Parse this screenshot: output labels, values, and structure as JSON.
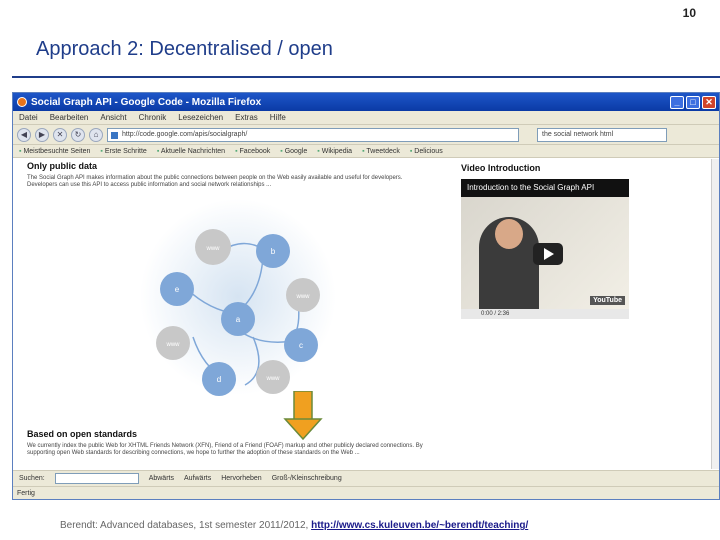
{
  "slide": {
    "number": "10",
    "title": "Approach 2: Decentralised / open",
    "footer_text": "Berendt: Advanced databases, 1st semester 2011/2012, ",
    "footer_link": "http://www.cs.kuleuven.be/~berendt/teaching/"
  },
  "browser": {
    "window_title": "Social Graph API - Google Code - Mozilla Firefox",
    "window_buttons": [
      "_",
      "□",
      "✕"
    ],
    "menu": [
      "Datei",
      "Bearbeiten",
      "Ansicht",
      "Chronik",
      "Lesezeichen",
      "Extras",
      "Hilfe"
    ],
    "nav_buttons": [
      "◀",
      "▶",
      "✕",
      "↻",
      "⌂"
    ],
    "url": "http://code.google.com/apis/socialgraph/",
    "search_value": "the social network html",
    "bookmarks": [
      "Meistbesuchte Seiten",
      "Erste Schritte",
      "Aktuelle Nachrichten",
      "Facebook",
      "Google",
      "Wikipedia",
      "Tweetdeck",
      "Delicious"
    ],
    "find_label": "Suchen:",
    "find_buttons": [
      "Abwärts",
      "Aufwärts",
      "Hervorheben",
      "Groß-/Kleinschreibung"
    ],
    "status": "Fertig"
  },
  "page": {
    "heading_public": "Only public data",
    "public_text": "The Social Graph API makes information about the public connections between people on the Web easily available and useful for developers. Developers can use this API to access public information and social network relationships ...",
    "heading_standards": "Based on open standards",
    "standards_text": "We currently index the public Web for XHTML Friends Network (XFN), Friend of a Friend (FOAF) markup and other publicly declared connections. By supporting open Web standards for describing connections, we hope to further the adoption of these standards on the Web ...",
    "video_heading": "Video Introduction",
    "video_title": "Introduction to the Social Graph API",
    "video_time": "0:00 / 2:36",
    "video_brand": "YouTube",
    "graph_nodes": [
      {
        "label": "www"
      },
      {
        "label": "b"
      },
      {
        "label": "e"
      },
      {
        "label": "www"
      },
      {
        "label": "a"
      },
      {
        "label": "www"
      },
      {
        "label": "c"
      },
      {
        "label": "d"
      },
      {
        "label": "www"
      }
    ]
  }
}
